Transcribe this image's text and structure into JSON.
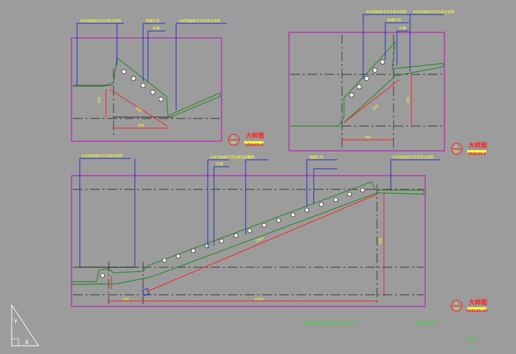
{
  "colors": {
    "background": "#9c9c9c",
    "frame": "#c000c0",
    "dimension": "#ff1a1a",
    "leader": "#1a2acc",
    "outline": "#2a8a2a",
    "callout_text": "#ffff33",
    "title_text": "#ff2222",
    "scale_bar": "#ffff33",
    "center_line": "#111111",
    "note_text": "#33dd33",
    "ucs": "#ffffff"
  },
  "drawings": [
    {
      "id": "top-left",
      "callouts": [
        "木纹饰面做法详见做法说明",
        "暗藏灯管",
        "灯带",
        "木纹饰面做法详见做法说明"
      ],
      "dims": [
        "350",
        "900",
        "250"
      ],
      "title": "大样图",
      "scale": "SCALE1:8",
      "marker_top": "1",
      "marker_bottom": "54"
    },
    {
      "id": "top-right",
      "callouts": [
        "木纹饰面做法详见做法说明",
        "暗藏灯管",
        "灯带",
        "木纹饰面做法详见做法说明"
      ],
      "dims": [
        "350",
        "800",
        "290"
      ],
      "title": "大样图",
      "scale": "SCALE1:8",
      "marker_top": "2",
      "marker_bottom": "54"
    },
    {
      "id": "bottom",
      "callouts": [
        "木纹饰面做法详见做法说明",
        "木纹饰面做法详见做法说明",
        "灯带",
        "灯带",
        "暗藏灯管",
        "木纹饰面做法详见做法说明"
      ],
      "dims": [
        "2900",
        "250",
        "1800",
        "350"
      ],
      "title": "大样图",
      "scale": "SCALE1:10",
      "marker_top": "3",
      "marker_bottom": "54"
    }
  ],
  "notes": [
    "台阶踏步做法详见楼梯大样施工图",
    "一层楼梯大样图"
  ],
  "corner_notes": [
    "比例尺",
    "1:50"
  ],
  "ucs": {
    "y": "Y",
    "x": "X"
  }
}
